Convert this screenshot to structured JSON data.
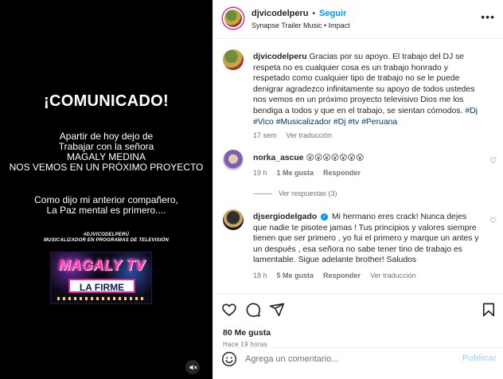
{
  "media": {
    "title": "¡COMUNICADO!",
    "paragraph1": [
      "Apartir de hoy dejo de",
      "Trabajar con la señora",
      "MAGALY MEDINA",
      "NOS VEMOS EN UN PRÓXIMO PROYECTO"
    ],
    "paragraph2": [
      "Como dijo mi anterior compañero,",
      "La Paz mental es primero...."
    ],
    "tagline": [
      "#DJVICODELPERÚ",
      "MUSICALIZADOR EN PROGRAMAS DE TELEVISIÓN"
    ],
    "logo_top": "MAGALY TV",
    "logo_bottom": "LA FIRME",
    "mute_icon": "speaker-muted-icon"
  },
  "post_header": {
    "username": "djvicodelperu",
    "separator": "•",
    "follow_label": "Seguir",
    "audio": "Synapse Trailer Music • Impact",
    "more": "•••"
  },
  "caption": {
    "username": "djvicodelperu",
    "text": "Gracias por su apoyo. El trabajo del DJ se respeta no es cualquier cosa es un trabajo honrado y respetado como cualquier tipo de trabajo no se le puede denigrar agradezco infinitamente su apoyo de todos ustedes nos vemos en un próximo proyecto televisivo Dios me los bendiga a todos y que en el trabajo, se sientan cómodos.",
    "hashtags": "#Dj #Vico #Musicalizador #Dj #tv #Peruana",
    "time": "17 sem",
    "translate": "Ver traducción"
  },
  "comments": [
    {
      "username": "norka_ascue",
      "text": "😮😮😮😮😮😮😮",
      "time": "19 h",
      "likes": "1 Me gusta",
      "reply": "Responder",
      "view_replies": "Ver respuestas (3)"
    },
    {
      "username": "djsergiodelgado",
      "verified": "✓",
      "text": "Mi hermano eres crack! Nunca dejes que nadie te pisotee jamas ! Tus principios y valores siempre tienen que ser primero , yo fui el primero y marque un antes y un después , esa señora no sabe tener tino de trabajo es lamentable. Sigue adelante brother! Saludos",
      "time": "18 h",
      "likes": "5 Me gusta",
      "reply": "Responder",
      "translate": "Ver traducción"
    }
  ],
  "actions": {
    "like_icon": "heart-icon",
    "comment_icon": "comment-icon",
    "share_icon": "share-icon",
    "save_icon": "bookmark-icon",
    "likes": "80 Me gusta",
    "ago": "Hace 19 horas"
  },
  "composer": {
    "placeholder": "Agrega un comentario...",
    "post_label": "Publicar",
    "emoji_icon": "emoji-icon"
  },
  "colors": {
    "accent": "#0095f6",
    "hashtag": "#00376b",
    "muted": "#737373",
    "post_disabled": "#b3dbff"
  }
}
